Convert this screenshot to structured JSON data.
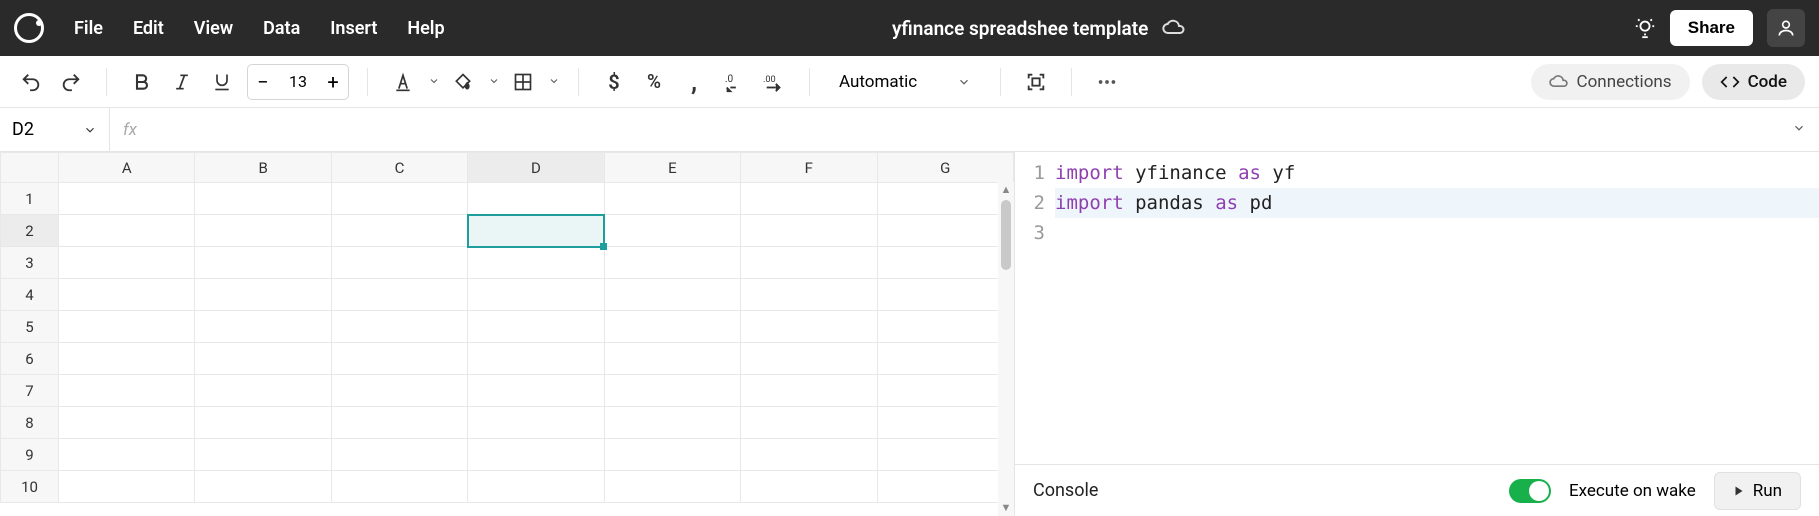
{
  "header": {
    "menu": [
      "File",
      "Edit",
      "View",
      "Data",
      "Insert",
      "Help"
    ],
    "title": "yfinance spreadshee template",
    "share_label": "Share"
  },
  "toolbar": {
    "font_size": "13",
    "number_format": "Automatic",
    "connections_label": "Connections",
    "code_label": "Code"
  },
  "formula_bar": {
    "cell_ref": "D2",
    "fx_label": "fx",
    "formula": ""
  },
  "sheet": {
    "columns": [
      "A",
      "B",
      "C",
      "D",
      "E",
      "F",
      "G"
    ],
    "row_count": 10,
    "selected_cell": {
      "col": 3,
      "row": 1
    }
  },
  "code": {
    "lines": [
      {
        "tokens": [
          [
            "kw",
            "import"
          ],
          [
            "sp",
            " "
          ],
          [
            "id",
            "yfinance"
          ],
          [
            "sp",
            " "
          ],
          [
            "kw",
            "as"
          ],
          [
            "sp",
            " "
          ],
          [
            "id",
            "yf"
          ]
        ]
      },
      {
        "tokens": [
          [
            "kw",
            "import"
          ],
          [
            "sp",
            " "
          ],
          [
            "id",
            "pandas"
          ],
          [
            "sp",
            " "
          ],
          [
            "kw",
            "as"
          ],
          [
            "sp",
            " "
          ],
          [
            "id",
            "pd"
          ]
        ]
      },
      {
        "tokens": []
      }
    ],
    "current_line": 1
  },
  "console": {
    "label": "Console",
    "execute_label": "Execute on wake",
    "run_label": "Run"
  }
}
